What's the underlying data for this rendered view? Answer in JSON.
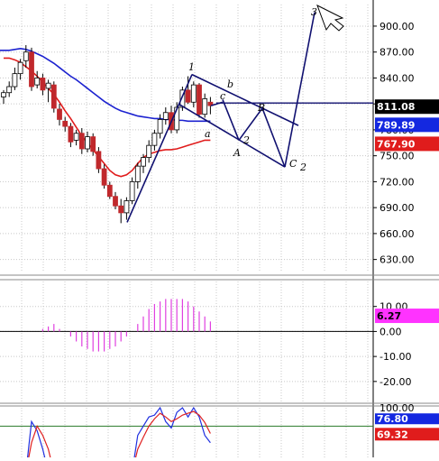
{
  "colors": {
    "grid": "#c8c8c8",
    "frame": "#000000",
    "candle_up": "#ffffff",
    "candle_down": "#c0282c",
    "ma_fast": "#e01c1c",
    "ma_slow": "#1c22d0",
    "wave": "#101070",
    "macd": "#e040e0",
    "stoch_k": "#2030e0",
    "stoch_d": "#e02020",
    "stoch_ref": "#2a7a2a",
    "tag_price": "#000000",
    "tag_blue": "#1428e0",
    "tag_red": "#e01c1c",
    "tag_magenta": "#ff33ff"
  },
  "chart_data": [
    {
      "type": "candlestick",
      "panel": "price",
      "ylim": [
        615,
        925
      ],
      "y_ticks": [
        "630.00",
        "660.00",
        "690.00",
        "720.00",
        "750.00",
        "780.00",
        "810.00",
        "840.00",
        "870.00",
        "900.00"
      ],
      "last_values": [
        {
          "label": "811.08",
          "role": "price"
        },
        {
          "label": "789.89",
          "role": "ma_slow"
        },
        {
          "label": "767.90",
          "role": "ma_fast"
        }
      ],
      "candles": [
        {
          "o": 818,
          "h": 826,
          "l": 810,
          "c": 823
        },
        {
          "o": 823,
          "h": 836,
          "l": 818,
          "c": 830
        },
        {
          "o": 830,
          "h": 852,
          "l": 826,
          "c": 845
        },
        {
          "o": 845,
          "h": 862,
          "l": 838,
          "c": 858
        },
        {
          "o": 860,
          "h": 878,
          "l": 852,
          "c": 870
        },
        {
          "o": 870,
          "h": 875,
          "l": 825,
          "c": 830
        },
        {
          "o": 832,
          "h": 848,
          "l": 828,
          "c": 840
        },
        {
          "o": 840,
          "h": 845,
          "l": 820,
          "c": 826
        },
        {
          "o": 828,
          "h": 838,
          "l": 812,
          "c": 834
        },
        {
          "o": 832,
          "h": 836,
          "l": 800,
          "c": 805
        },
        {
          "o": 804,
          "h": 810,
          "l": 785,
          "c": 792
        },
        {
          "o": 790,
          "h": 795,
          "l": 778,
          "c": 784
        },
        {
          "o": 784,
          "h": 788,
          "l": 760,
          "c": 766
        },
        {
          "o": 768,
          "h": 780,
          "l": 762,
          "c": 776
        },
        {
          "o": 776,
          "h": 782,
          "l": 752,
          "c": 758
        },
        {
          "o": 758,
          "h": 778,
          "l": 754,
          "c": 772
        },
        {
          "o": 772,
          "h": 776,
          "l": 750,
          "c": 755
        },
        {
          "o": 755,
          "h": 760,
          "l": 730,
          "c": 735
        },
        {
          "o": 735,
          "h": 740,
          "l": 712,
          "c": 716
        },
        {
          "o": 716,
          "h": 720,
          "l": 700,
          "c": 703
        },
        {
          "o": 703,
          "h": 708,
          "l": 688,
          "c": 692
        },
        {
          "o": 692,
          "h": 700,
          "l": 672,
          "c": 684
        },
        {
          "o": 684,
          "h": 702,
          "l": 676,
          "c": 698
        },
        {
          "o": 698,
          "h": 725,
          "l": 694,
          "c": 720
        },
        {
          "o": 720,
          "h": 742,
          "l": 712,
          "c": 738
        },
        {
          "o": 738,
          "h": 752,
          "l": 730,
          "c": 748
        },
        {
          "o": 748,
          "h": 768,
          "l": 742,
          "c": 762
        },
        {
          "o": 762,
          "h": 780,
          "l": 756,
          "c": 776
        },
        {
          "o": 776,
          "h": 798,
          "l": 770,
          "c": 792
        },
        {
          "o": 792,
          "h": 806,
          "l": 786,
          "c": 800
        },
        {
          "o": 800,
          "h": 808,
          "l": 776,
          "c": 780
        },
        {
          "o": 780,
          "h": 812,
          "l": 776,
          "c": 806
        },
        {
          "o": 806,
          "h": 830,
          "l": 802,
          "c": 826
        },
        {
          "o": 826,
          "h": 842,
          "l": 810,
          "c": 812
        },
        {
          "o": 812,
          "h": 836,
          "l": 806,
          "c": 832
        },
        {
          "o": 832,
          "h": 834,
          "l": 794,
          "c": 798
        },
        {
          "o": 798,
          "h": 822,
          "l": 794,
          "c": 816
        },
        {
          "o": 812,
          "h": 818,
          "l": 798,
          "c": 808
        }
      ],
      "ma_slow": [
        872,
        872,
        873,
        874,
        873,
        871,
        868,
        865,
        861,
        857,
        852,
        847,
        842,
        838,
        833,
        828,
        823,
        818,
        813,
        809,
        805,
        802,
        800,
        798,
        796,
        795,
        794,
        793,
        793,
        792,
        792,
        791,
        791,
        790,
        790,
        790,
        790,
        790
      ],
      "ma_fast": [
        863,
        863,
        861,
        858,
        853,
        848,
        842,
        835,
        828,
        821,
        812,
        802,
        793,
        783,
        773,
        765,
        757,
        749,
        741,
        733,
        728,
        726,
        728,
        733,
        741,
        748,
        752,
        754,
        756,
        757,
        757,
        758,
        760,
        762,
        764,
        766,
        768,
        768
      ]
    },
    {
      "type": "bar",
      "panel": "macd",
      "ylim": [
        -28,
        20
      ],
      "y_ticks": [
        "-20.00",
        "-10.00",
        "0.00",
        "10.00"
      ],
      "last_value": "6.27",
      "values": [
        0,
        0,
        0,
        0,
        0,
        0,
        0,
        1,
        2,
        3,
        1,
        0,
        -2,
        -4,
        -6,
        -7,
        -8,
        -8,
        -8,
        -7,
        -6,
        -4,
        -2,
        0,
        3,
        6,
        9,
        11,
        12,
        13,
        13,
        13,
        13,
        12,
        10,
        8,
        6,
        4
      ]
    },
    {
      "type": "line",
      "panel": "stochastic",
      "ylim": [
        46,
        100
      ],
      "y_ticks": [
        "100.00"
      ],
      "last_values": [
        "76.80",
        "69.32"
      ],
      "reference_level": 80,
      "k": [
        30,
        30,
        30,
        30,
        30,
        85,
        75,
        55,
        30,
        30,
        30,
        30,
        30,
        30,
        30,
        30,
        30,
        30,
        30,
        30,
        30,
        30,
        30,
        30,
        70,
        80,
        90,
        92,
        100,
        85,
        78,
        95,
        100,
        90,
        100,
        90,
        70,
        62
      ],
      "d": [
        30,
        30,
        30,
        30,
        30,
        62,
        80,
        70,
        55,
        30,
        30,
        30,
        30,
        30,
        30,
        30,
        30,
        30,
        30,
        30,
        30,
        30,
        30,
        30,
        55,
        68,
        80,
        88,
        94,
        90,
        85,
        88,
        92,
        94,
        96,
        92,
        84,
        72
      ]
    }
  ],
  "wave_labels": {
    "w1": "1",
    "w3": "3",
    "b": "b",
    "a": "a",
    "c": "c",
    "wA": "A",
    "wB": "B",
    "wC": "C",
    "w2a": "2",
    "w2b": "2"
  }
}
